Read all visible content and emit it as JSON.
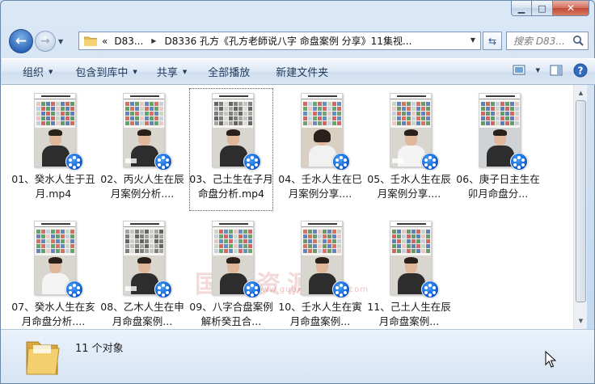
{
  "window": {
    "caption_minimize": "▁",
    "caption_maximize": "□",
    "caption_close": "✕"
  },
  "address": {
    "overflow": "«",
    "crumb1": "D83...",
    "crumb2": "D8336 孔方《孔方老師说八字 命盘案例 分享》11集视..."
  },
  "search": {
    "placeholder": "搜索 D83..."
  },
  "toolbar": {
    "organize": "组织",
    "include_in_library": "包含到库中",
    "share": "共享",
    "play_all": "全部播放",
    "new_folder": "新建文件夹"
  },
  "files": [
    {
      "label": "01、癸水人生于丑月.mp4",
      "selected": false
    },
    {
      "label": "02、丙火人生在辰月案例分析....",
      "selected": false
    },
    {
      "label": "03、己土生在子月命盘分析.mp4",
      "selected": true
    },
    {
      "label": "04、壬水人生在巳月案例分享....",
      "selected": false
    },
    {
      "label": "05、壬水人生在辰月案例分享....",
      "selected": false
    },
    {
      "label": "06、庚子日主生在卯月命盘分...",
      "selected": false
    },
    {
      "label": "07、癸水人生在亥月命盘分析....",
      "selected": false
    },
    {
      "label": "08、乙木人生在申月命盘案例...",
      "selected": false
    },
    {
      "label": "09、八字合盘案例解析癸丑合...",
      "selected": false
    },
    {
      "label": "10、壬水人生在寅月命盘案例...",
      "selected": false
    },
    {
      "label": "11、己土人生在辰月命盘案例...",
      "selected": false
    }
  ],
  "watermark": {
    "text": "国学资源网",
    "url": "www.guoxueziyuan.com"
  },
  "status": {
    "count": "11 个对象"
  },
  "colors": {
    "accent": "#2d67b8",
    "selection_outline": "#555555"
  }
}
